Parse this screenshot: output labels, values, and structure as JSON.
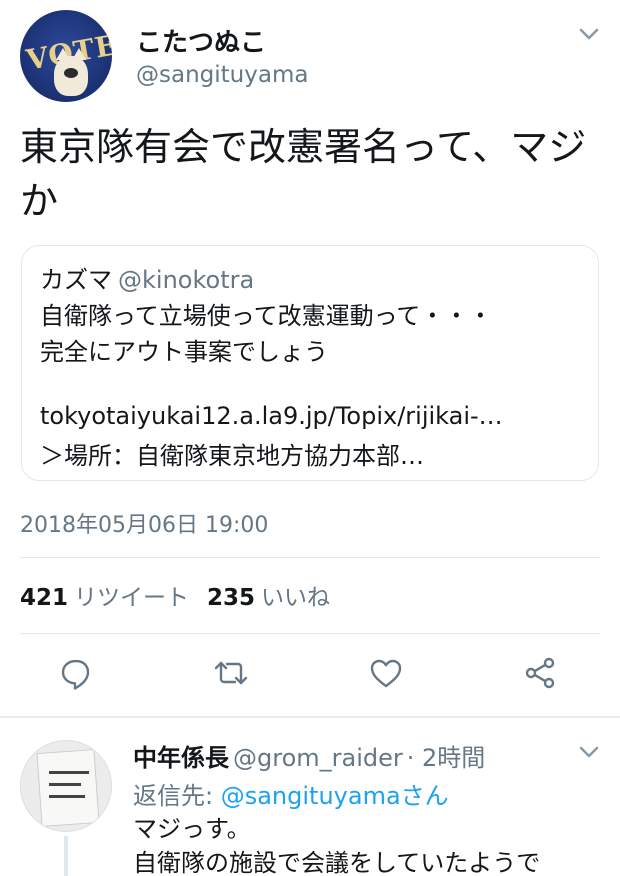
{
  "tweet": {
    "display_name": "こたつぬこ",
    "handle": "@sangituyama",
    "avatar_text": "VOTE",
    "text": "東京隊有会で改憲署名って、マジか",
    "quote": {
      "name": "カズマ",
      "handle": "@kinokotra",
      "lines": [
        "自衛隊って立場使って改憲運動って・・・",
        "完全にアウト事案でしょう",
        "tokyotaiyukai12.a.la9.jp/Topix/rijikai-…",
        "＞場所：自衛隊東京地方協力本部…"
      ]
    },
    "timestamp": "2018年05月06日 19:00",
    "stats": {
      "retweets": "421",
      "retweets_label": "リツイート",
      "likes": "235",
      "likes_label": "いいね"
    },
    "actions": [
      "reply-icon",
      "retweet-icon",
      "like-icon",
      "share-icon"
    ]
  },
  "reply": {
    "display_name": "中年係長",
    "handle": "@grom_raider",
    "time": "· 2時間",
    "to_label": "返信先: ",
    "to_mention": "@sangituyamaさん",
    "text_lines": [
      "マジっす。",
      "自衛隊の施設で会議をしていたようで"
    ]
  },
  "colors": {
    "text": "#14171a",
    "secondary": "#657786",
    "link": "#1da1f2",
    "border": "#e1e8ed"
  }
}
